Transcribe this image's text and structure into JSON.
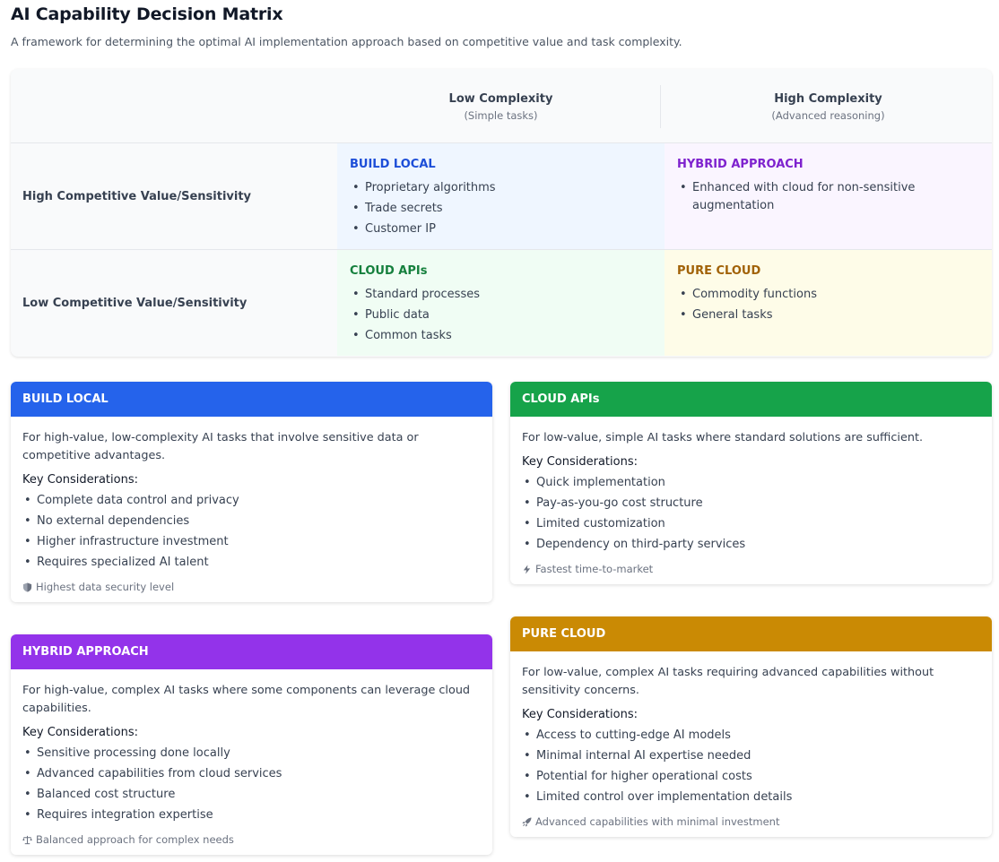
{
  "header": {
    "title": "AI Capability Decision Matrix",
    "subtitle": "A framework for determining the optimal AI implementation approach based on competitive value and task complexity."
  },
  "matrix": {
    "columns": [
      {
        "label": "Low Complexity",
        "sub": "(Simple tasks)"
      },
      {
        "label": "High Complexity",
        "sub": "(Advanced reasoning)"
      }
    ],
    "rows": [
      {
        "label": "High Competitive Value/Sensitivity"
      },
      {
        "label": "Low Competitive Value/Sensitivity"
      }
    ],
    "cells": {
      "build_local": {
        "title": "BUILD LOCAL",
        "color": "#1d4ed8",
        "bg": "#eff6ff",
        "items": [
          "Proprietary algorithms",
          "Trade secrets",
          "Customer IP"
        ]
      },
      "hybrid": {
        "title": "HYBRID APPROACH",
        "color": "#7e22ce",
        "bg": "#faf5ff",
        "items": [
          "Enhanced with cloud for non-sensitive augmentation"
        ]
      },
      "cloud_apis": {
        "title": "CLOUD APIs",
        "color": "#15803d",
        "bg": "#f0fdf4",
        "items": [
          "Standard processes",
          "Public data",
          "Common tasks"
        ]
      },
      "pure_cloud": {
        "title": "PURE CLOUD",
        "color": "#a16207",
        "bg": "#fefce8",
        "items": [
          "Commodity functions",
          "General tasks"
        ]
      }
    }
  },
  "cards": {
    "build_local": {
      "title": "BUILD LOCAL",
      "color": "#2563eb",
      "desc": "For high-value, low-complexity AI tasks that involve sensitive data or competitive advantages.",
      "kc": "Key Considerations:",
      "items": [
        "Complete data control and privacy",
        "No external dependencies",
        "Higher infrastructure investment",
        "Requires specialized AI talent"
      ],
      "footer": "Highest data security level",
      "footer_icon": "shield-icon"
    },
    "cloud_apis": {
      "title": "CLOUD APIs",
      "color": "#16a34a",
      "desc": "For low-value, simple AI tasks where standard solutions are sufficient.",
      "kc": "Key Considerations:",
      "items": [
        "Quick implementation",
        "Pay-as-you-go cost structure",
        "Limited customization",
        "Dependency on third-party services"
      ],
      "footer": "Fastest time-to-market",
      "footer_icon": "bolt-icon"
    },
    "hybrid": {
      "title": "HYBRID APPROACH",
      "color": "#9333ea",
      "desc": "For high-value, complex AI tasks where some components can leverage cloud capabilities.",
      "kc": "Key Considerations:",
      "items": [
        "Sensitive processing done locally",
        "Advanced capabilities from cloud services",
        "Balanced cost structure",
        "Requires integration expertise"
      ],
      "footer": "Balanced approach for complex needs",
      "footer_icon": "scale-icon"
    },
    "pure_cloud": {
      "title": "PURE CLOUD",
      "color": "#ca8a04",
      "desc": "For low-value, complex AI tasks requiring advanced capabilities without sensitivity concerns.",
      "kc": "Key Considerations:",
      "items": [
        "Access to cutting-edge AI models",
        "Minimal internal AI expertise needed",
        "Potential for higher operational costs",
        "Limited control over implementation details"
      ],
      "footer": "Advanced capabilities with minimal investment",
      "footer_icon": "rocket-icon"
    }
  }
}
